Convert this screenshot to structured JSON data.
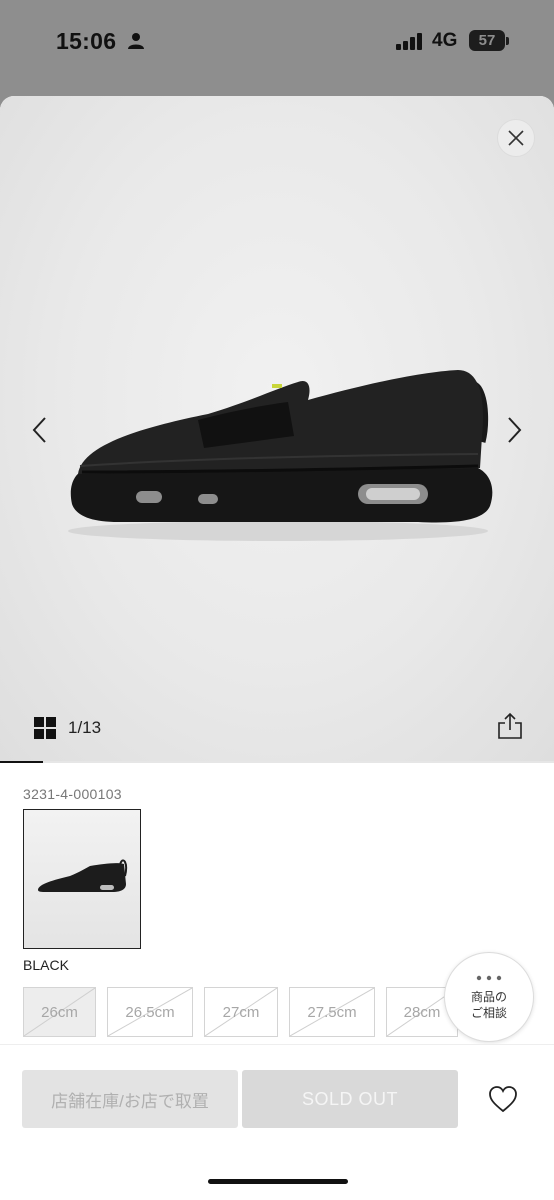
{
  "status_bar": {
    "time": "15:06",
    "network": "4G",
    "battery": "57"
  },
  "gallery": {
    "counter": "1/13",
    "image_index": 1,
    "image_total": 13,
    "alt": "black leather loafer sneaker with air sole"
  },
  "product": {
    "code": "3231-4-000103",
    "color_name": "BLACK",
    "sizes": [
      {
        "label": "26cm",
        "available": false,
        "selected": true
      },
      {
        "label": "26.5cm",
        "available": false,
        "selected": false
      },
      {
        "label": "27cm",
        "available": false,
        "selected": false
      },
      {
        "label": "27.5cm",
        "available": false,
        "selected": false
      },
      {
        "label": "28cm",
        "available": false,
        "selected": false
      }
    ]
  },
  "consult": {
    "label": "商品の\nご相談"
  },
  "actions": {
    "store_label": "店舗在庫/お店で取置",
    "soldout_label": "SOLD OUT"
  },
  "icons": {
    "close": "close-icon",
    "prev": "chevron-left-icon",
    "next": "chevron-right-icon",
    "grid": "grid-icon",
    "share": "share-icon",
    "favorite": "heart-icon",
    "more": "ellipsis-icon"
  },
  "colors": {
    "accent": "#111111",
    "disabled_text": "#b0b0b0",
    "soldout_bg": "#d9d9d9"
  }
}
